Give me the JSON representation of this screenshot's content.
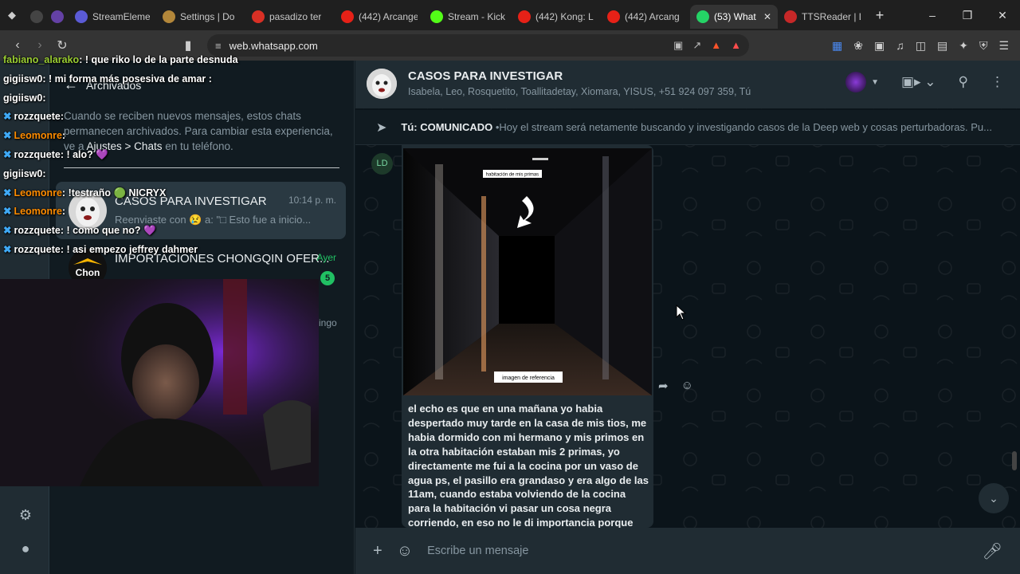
{
  "browser": {
    "tabs": [
      {
        "label": "",
        "fav_color": "#444"
      },
      {
        "label": "",
        "fav_color": "#6441a5"
      },
      {
        "label": "StreamElements",
        "fav_color": "#5b5bd6"
      },
      {
        "label": "Settings | Do",
        "fav_color": "#b3873a"
      },
      {
        "label": "pasadizo ter",
        "fav_color": "#d93025"
      },
      {
        "label": "(442) Arcange",
        "fav_color": "#e62117"
      },
      {
        "label": "Stream - Kick",
        "fav_color": "#53fc18"
      },
      {
        "label": "(442) Kong: L",
        "fav_color": "#e62117"
      },
      {
        "label": "(442) Arcang",
        "fav_color": "#e62117"
      },
      {
        "label": "(53) What",
        "fav_color": "#25d366",
        "active": true
      },
      {
        "label": "TTSReader | L",
        "fav_color": "#c62828"
      }
    ],
    "url": "web.whatsapp.com"
  },
  "sidebar": {
    "archived_title": "Archivados",
    "archived_info_1": "Cuando se reciben nuevos mensajes, estos chats permanecen archivados. Para cambiar esta experiencia, ve a ",
    "archived_info_link": "Ajustes > Chats",
    "archived_info_2": " en tu teléfono.",
    "chats": [
      {
        "name": "CASOS PARA INVESTIGAR",
        "time": "10:14 p. m.",
        "preview": "Reenviaste con 😢 a: \"□ Esto fue a inicio...",
        "selected": true
      },
      {
        "name": "IMPORTACIONES CHONGQIN OFER...",
        "time": "Ayer",
        "preview": "",
        "badge": "5"
      }
    ],
    "partial_text": "ingo"
  },
  "stream_chat": [
    {
      "user": "fabiano_alarako",
      "color": "#9acd32",
      "msg": "! que riko lo de la parte desnuda",
      "pin": false
    },
    {
      "user": "gigiisw0",
      "color": "#ffffff",
      "msg": "! mi forma más posesiva de amar :",
      "pin": false
    },
    {
      "user": "gigiisw0",
      "color": "#ffffff",
      "msg": "",
      "pin": false
    },
    {
      "user": "rozzquete",
      "color": "#ffffff",
      "msg": "",
      "pin": true
    },
    {
      "user": "Leomonre",
      "color": "#ff8c00",
      "msg": "",
      "pin": true
    },
    {
      "user": "rozzquete",
      "color": "#ffffff",
      "msg": "! alo? 💜",
      "pin": true
    },
    {
      "user": "gigiisw0",
      "color": "#ffffff",
      "msg": "",
      "pin": false
    },
    {
      "user": "Leomonre",
      "color": "#ff8c00",
      "msg": "!testraño 🟢 NICRYX",
      "pin": true
    },
    {
      "user": "Leomonre",
      "color": "#ff8c00",
      "msg": "",
      "pin": true
    },
    {
      "user": "rozzquete",
      "color": "#ffffff",
      "msg": "! como que no? 💜",
      "pin": true
    },
    {
      "user": "rozzquete",
      "color": "#ffffff",
      "msg": "! asi empezo jeffrey dahmer",
      "pin": true
    }
  ],
  "conversation": {
    "title": "CASOS PARA INVESTIGAR",
    "members": "Isabela, Leo, Rosquetito, Toallitadetay, Xiomara, YISUS, +51 924 097 359, Tú",
    "pinned_sender": "Tú: COMUNICADO",
    "pinned_text": " •Hoy el stream será netamente buscando y investigando casos de la Deep web y cosas perturbadoras. Pu...",
    "message_avatar_initials": "LD",
    "image_caption_top": "habitación de mis primas",
    "image_caption_bottom": "imagen de referencia",
    "message_text": "el echo es que en una mañana yo habia despertado muy tarde en la casa de mis tios, me habia dormido con mi hermano y mis primos en la otra habitación estaban mis 2 primas, yo directamente me fui a la cocina por un vaso de agua ps, el pasillo era grandaso y era algo de las 11am, cuando estaba volviendo de la cocina para la habitación vi pasar un cosa negra corriendo, en eso no le di importancia porque pense que eran",
    "composer_placeholder": "Escribe un mensaje"
  },
  "colors": {
    "whatsapp_green": "#25d366",
    "panel_bg": "#202c33",
    "chat_bg": "#0b141a"
  }
}
